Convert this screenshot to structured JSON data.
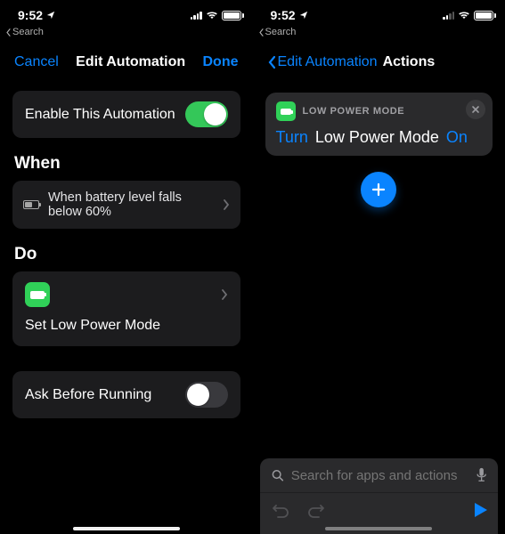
{
  "status": {
    "time": "9:52",
    "back_app": "Search"
  },
  "left": {
    "nav": {
      "cancel": "Cancel",
      "title": "Edit Automation",
      "done": "Done"
    },
    "enable": {
      "label": "Enable This Automation",
      "on": true
    },
    "when": {
      "header": "When",
      "condition": "When battery level falls below 60%"
    },
    "do": {
      "header": "Do",
      "action": "Set Low Power Mode"
    },
    "ask": {
      "label": "Ask Before Running",
      "on": false
    }
  },
  "right": {
    "nav": {
      "back": "Edit Automation",
      "title": "Actions"
    },
    "action_card": {
      "header": "LOW POWER MODE",
      "verb": "Turn",
      "object": "Low Power Mode",
      "state": "On"
    },
    "search_placeholder": "Search for apps and actions"
  }
}
